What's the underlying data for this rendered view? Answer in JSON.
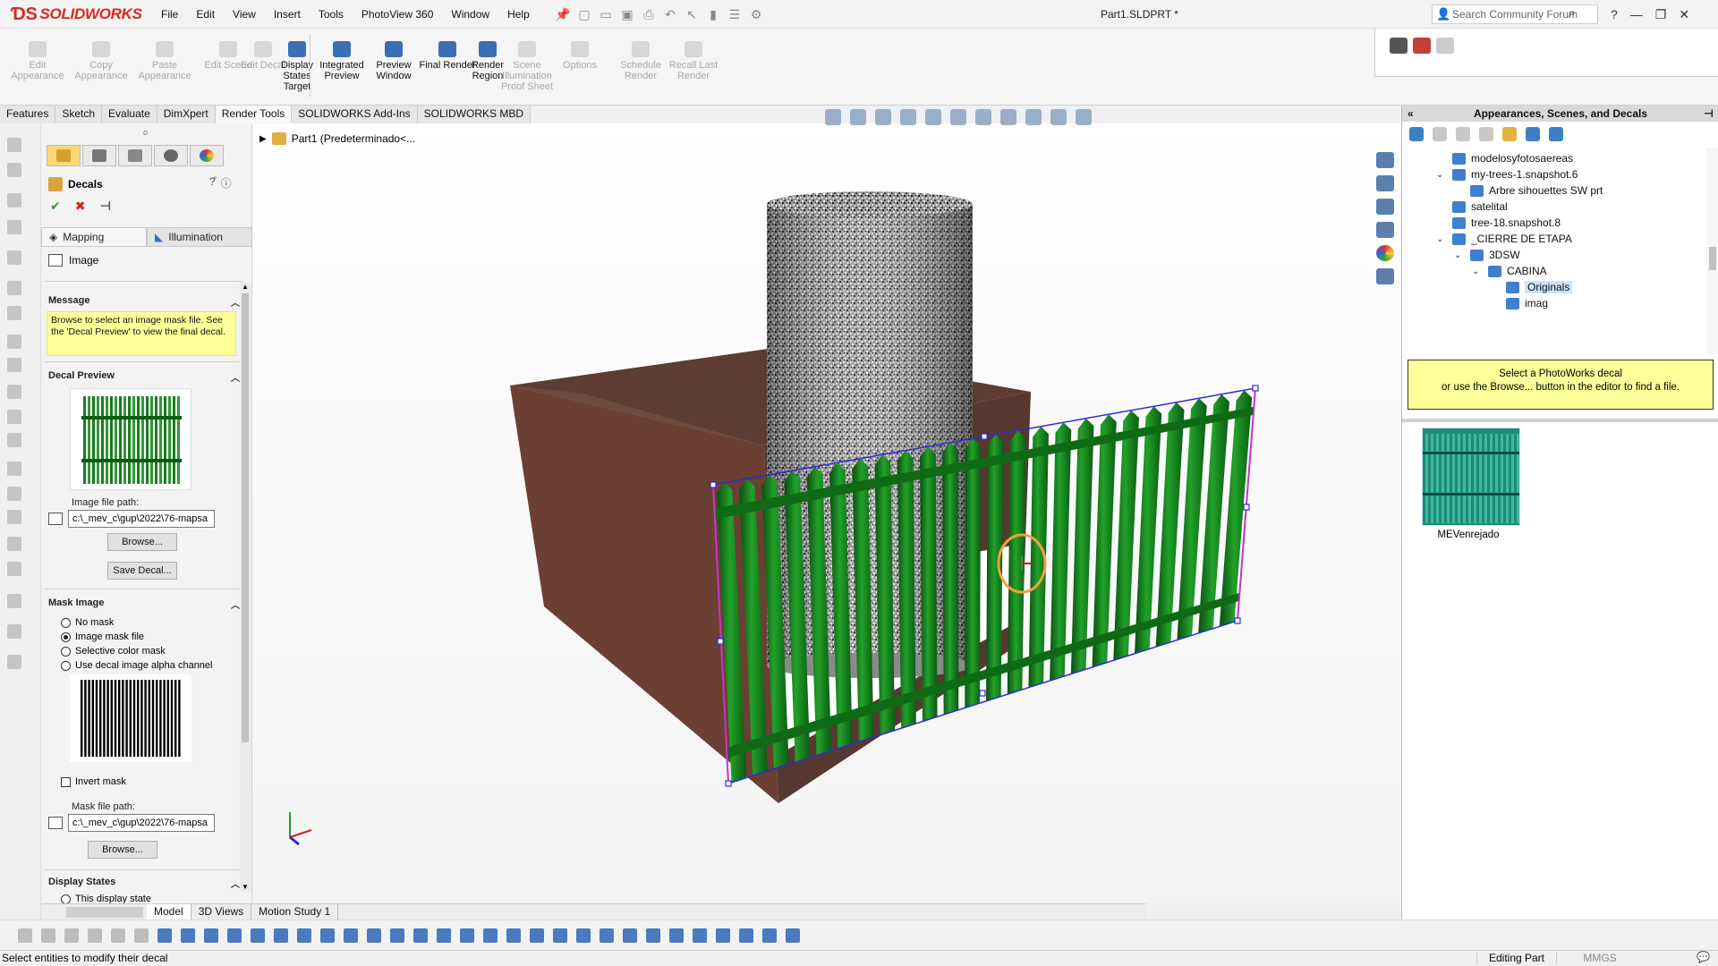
{
  "app": {
    "logo_text": "SOLIDWORKS",
    "document_title": "Part1.SLDPRT *"
  },
  "menu": [
    "File",
    "Edit",
    "View",
    "Insert",
    "Tools",
    "PhotoView 360",
    "Window",
    "Help"
  ],
  "search": {
    "placeholder": "Search Community Forum"
  },
  "commands": [
    {
      "label": "Edit Appearance",
      "enabled": false
    },
    {
      "label": "Copy Appearance",
      "enabled": false
    },
    {
      "label": "Paste Appearance",
      "enabled": false
    },
    {
      "label": "Edit Scene",
      "enabled": false
    },
    {
      "label": "Edit Decal",
      "enabled": false
    },
    {
      "label": "Display States Target",
      "enabled": true
    },
    {
      "label": "Integrated Preview",
      "enabled": true
    },
    {
      "label": "Preview Window",
      "enabled": true
    },
    {
      "label": "Final Render",
      "enabled": true
    },
    {
      "label": "Render Region",
      "enabled": true
    },
    {
      "label": "Scene Illumination Proof Sheet",
      "enabled": false
    },
    {
      "label": "Options",
      "enabled": false
    },
    {
      "label": "Schedule Render",
      "enabled": false
    },
    {
      "label": "Recall Last Render",
      "enabled": false
    }
  ],
  "tabs": [
    "Features",
    "Sketch",
    "Evaluate",
    "DimXpert",
    "Render Tools",
    "SOLIDWORKS Add-Ins",
    "SOLIDWORKS MBD"
  ],
  "active_tab": "Render Tools",
  "property_manager": {
    "title": "Decals",
    "subtabs": [
      "Mapping",
      "Illumination"
    ],
    "image_label": "Image",
    "message_header": "Message",
    "message": "Browse to select an image mask file. See the 'Decal Preview' to view the final decal.",
    "decal_preview_header": "Decal Preview",
    "image_path_label": "Image file path:",
    "image_path_value": "c:\\_mev_c\\gup\\2022\\76-mapsa",
    "browse_label": "Browse...",
    "save_decal_label": "Save Decal...",
    "mask_header": "Mask Image",
    "mask_options": [
      "No mask",
      "Image mask file",
      "Selective color mask",
      "Use decal image alpha channel"
    ],
    "mask_selected": 1,
    "invert_label": "Invert mask",
    "mask_path_label": "Mask file path:",
    "mask_path_value": "c:\\_mev_c\\gup\\2022\\76-mapsa",
    "mask_browse_label": "Browse...",
    "display_states_header": "Display States",
    "display_state_option": "This display state"
  },
  "tree_root": "Part1  (Predeterminado<...",
  "bottom_tabs": [
    "Model",
    "3D Views",
    "Motion Study 1"
  ],
  "active_bottom_tab": "Model",
  "task_pane": {
    "title": "Appearances, Scenes, and Decals",
    "tree": [
      {
        "label": "modelosyfotosaereas",
        "level": 1,
        "twisty": ""
      },
      {
        "label": "my-trees-1.snapshot.6",
        "level": 1,
        "twisty": "v"
      },
      {
        "label": "Arbre sihouettes SW prt",
        "level": 2,
        "twisty": ""
      },
      {
        "label": "satelital",
        "level": 1,
        "twisty": ""
      },
      {
        "label": "tree-18.snapshot.8",
        "level": 1,
        "twisty": ""
      },
      {
        "label": "_CIERRE DE ETAPA",
        "level": 1,
        "twisty": "v"
      },
      {
        "label": "3DSW",
        "level": 2,
        "twisty": "v"
      },
      {
        "label": "CABINA",
        "level": 3,
        "twisty": "v"
      },
      {
        "label": "Originals",
        "level": 4,
        "twisty": "",
        "selected": true
      },
      {
        "label": "imag",
        "level": 4,
        "twisty": ""
      }
    ],
    "note": "Select a PhotoWorks decal\nor use the Browse... button in the editor to find a file.",
    "thumbnail_label": "MEVenrejado"
  },
  "status": {
    "message": "Select entities to modify their decal",
    "mode": "Editing Part",
    "units": "MMGS"
  },
  "colors": {
    "accent": "#da291c",
    "fence": "#1b7a1f",
    "box": "#6b3f33",
    "selection": "#2b2bd6"
  }
}
